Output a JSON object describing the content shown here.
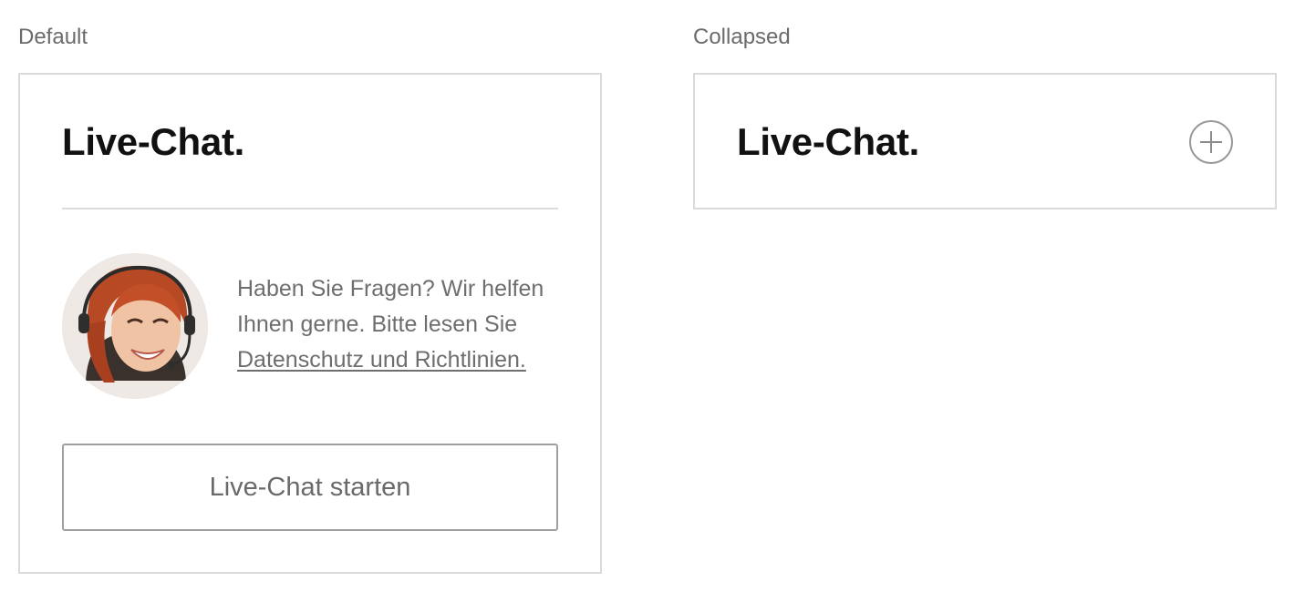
{
  "variants": {
    "default_label": "Default",
    "collapsed_label": "Collapsed"
  },
  "default_panel": {
    "title": "Live-Chat.",
    "avatar_icon": "support-agent-avatar",
    "intro_text": "Haben Sie Fragen? Wir helfen Ihnen gerne. Bitte lesen Sie ",
    "privacy_link": "Datenschutz und Richtlinien.",
    "start_button": "Live-Chat starten"
  },
  "collapsed_panel": {
    "title": "Live-Chat.",
    "expand_icon": "plus-circle-icon"
  }
}
